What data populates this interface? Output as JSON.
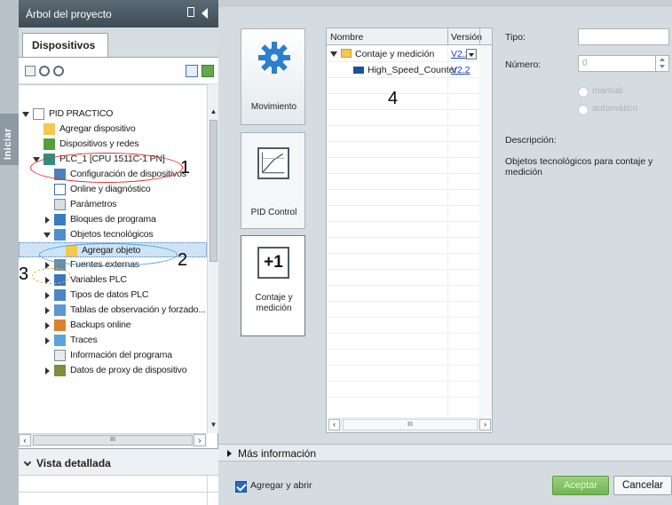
{
  "project_tree": {
    "title": "Árbol del proyecto",
    "side_tab": "Iniciar",
    "tab": "Dispositivos",
    "items": [
      {
        "label": "PID PRACTICO",
        "icon": "project-icon"
      },
      {
        "label": "Agregar dispositivo",
        "icon": "add-device-icon"
      },
      {
        "label": "Dispositivos y redes",
        "icon": "network-icon"
      },
      {
        "label": "PLC_1 [CPU 1511C-1 PN]",
        "icon": "plc-icon"
      },
      {
        "label": "Configuración de dispositivos",
        "icon": "device-config-icon"
      },
      {
        "label": "Online y diagnóstico",
        "icon": "diagnostic-icon"
      },
      {
        "label": "Parámetros",
        "icon": "parameters-icon"
      },
      {
        "label": "Bloques de programa",
        "icon": "program-blocks-icon"
      },
      {
        "label": "Objetos tecnológicos",
        "icon": "tech-objects-icon"
      },
      {
        "label": "Agregar objeto",
        "icon": "add-object-icon"
      },
      {
        "label": "Fuentes externas",
        "icon": "external-sources-icon"
      },
      {
        "label": "Variables PLC",
        "icon": "plc-tags-icon"
      },
      {
        "label": "Tipos de datos PLC",
        "icon": "plc-datatypes-icon"
      },
      {
        "label": "Tablas de observación y forzado...",
        "icon": "watch-tables-icon"
      },
      {
        "label": "Backups online",
        "icon": "backups-icon"
      },
      {
        "label": "Traces",
        "icon": "traces-icon"
      },
      {
        "label": "Información del programa",
        "icon": "program-info-icon"
      },
      {
        "label": "Datos de proxy de dispositivo",
        "icon": "proxy-data-icon"
      }
    ],
    "hscroll_thumb": "III",
    "detail_view": "Vista detallada"
  },
  "categories": [
    {
      "label": "Movimiento",
      "icon": "gear-icon"
    },
    {
      "label": "PID Control",
      "icon": "pid-graph-icon"
    },
    {
      "label": "Contaje y medición",
      "icon": "plus-one-icon",
      "icon_text": "+1"
    }
  ],
  "object_table": {
    "col_name": "Nombre",
    "col_version": "Versión",
    "rows": [
      {
        "name": "Contaje y medición",
        "version": "V2.2"
      },
      {
        "name": "High_Speed_Counter",
        "version": "V2.2"
      }
    ],
    "hscroll_thumb": "III"
  },
  "properties": {
    "tipo_label": "Tipo:",
    "tipo_value": "",
    "numero_label": "Número:",
    "numero_value": "0",
    "radio_manual": "manual",
    "radio_auto": "automático",
    "descripcion_label": "Descripción:",
    "descripcion_text": "Objetos tecnológicos para contaje y medición"
  },
  "more_info": "Más información",
  "footer": {
    "checkbox_label": "Agregar y abrir",
    "checkbox_checked": true,
    "accept": "Aceptar",
    "cancel": "Cancelar"
  },
  "annotations": {
    "n1": "1",
    "n2": "2",
    "n3": "3",
    "n4": "4"
  },
  "colors": {
    "accent": "#2c67c4",
    "accept_green": "#71b552",
    "oval_red": "#d9322f",
    "oval_blue": "#3ba8d8",
    "oval_yellow": "#e8b24a"
  }
}
